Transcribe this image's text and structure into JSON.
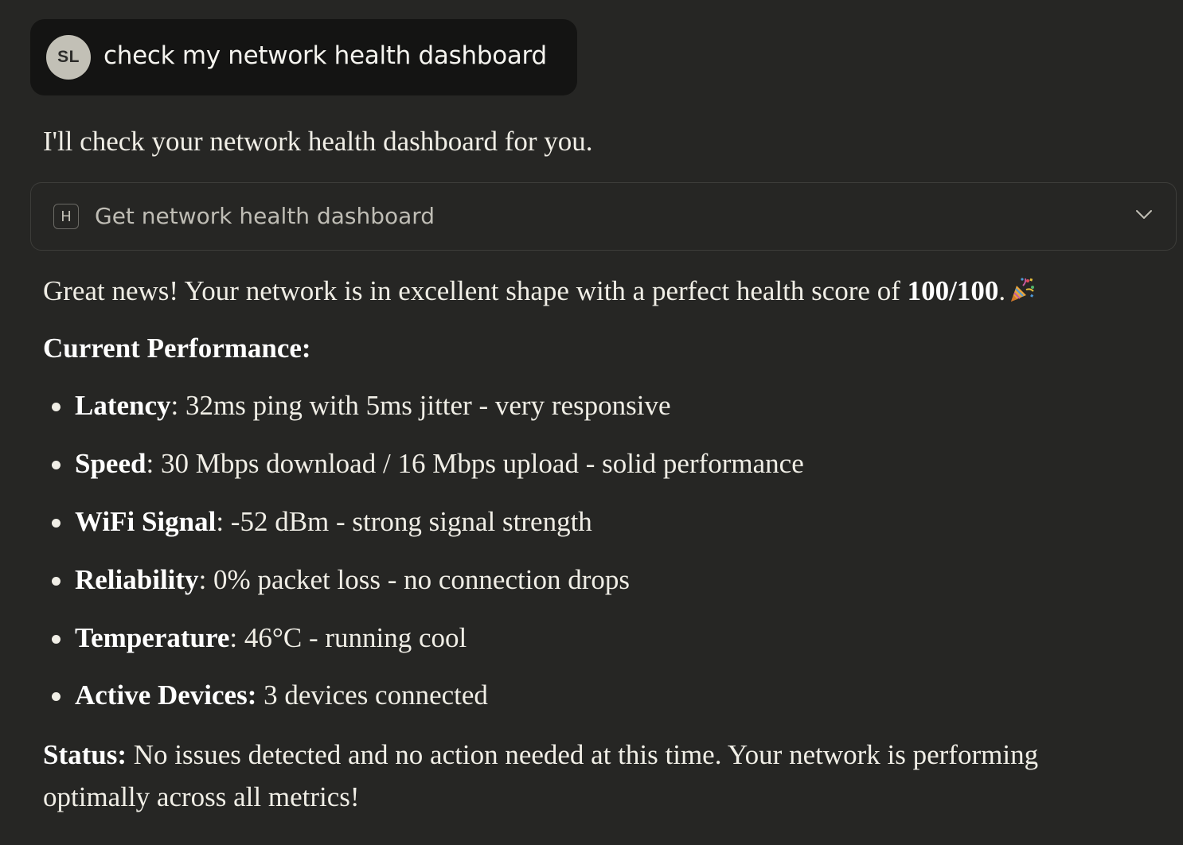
{
  "user_message": {
    "avatar_initials": "SL",
    "text": "check my network health dashboard"
  },
  "assistant": {
    "intro": "I'll check your network health dashboard for you.",
    "tool_call": {
      "icon_letter": "H",
      "label": "Get network health dashboard",
      "expand_icon": "chevron-down-icon"
    },
    "summary": {
      "prefix": "Great news! Your network is in excellent shape with a perfect health score of ",
      "score": "100/100",
      "suffix": ".",
      "emoji": "party-popper-icon"
    },
    "section_heading": "Current Performance:",
    "metrics": [
      {
        "label": "Latency",
        "text": ": 32ms ping with 5ms jitter - very responsive"
      },
      {
        "label": "Speed",
        "text": ": 30 Mbps download / 16 Mbps upload - solid performance"
      },
      {
        "label": "WiFi Signal",
        "text": ": -52 dBm - strong signal strength"
      },
      {
        "label": "Reliability",
        "text": ": 0% packet loss - no connection drops"
      },
      {
        "label": "Temperature",
        "text": ": 46°C - running cool"
      },
      {
        "label": "Active Devices:",
        "text": " 3 devices connected"
      }
    ],
    "status": {
      "label": "Status:",
      "text": " No issues detected and no action needed at this time. Your network is performing optimally across all metrics!"
    }
  },
  "colors": {
    "background": "#262624",
    "user_bubble": "#141413",
    "text": "#f0eee6",
    "tool_border": "#3d3d3a"
  }
}
